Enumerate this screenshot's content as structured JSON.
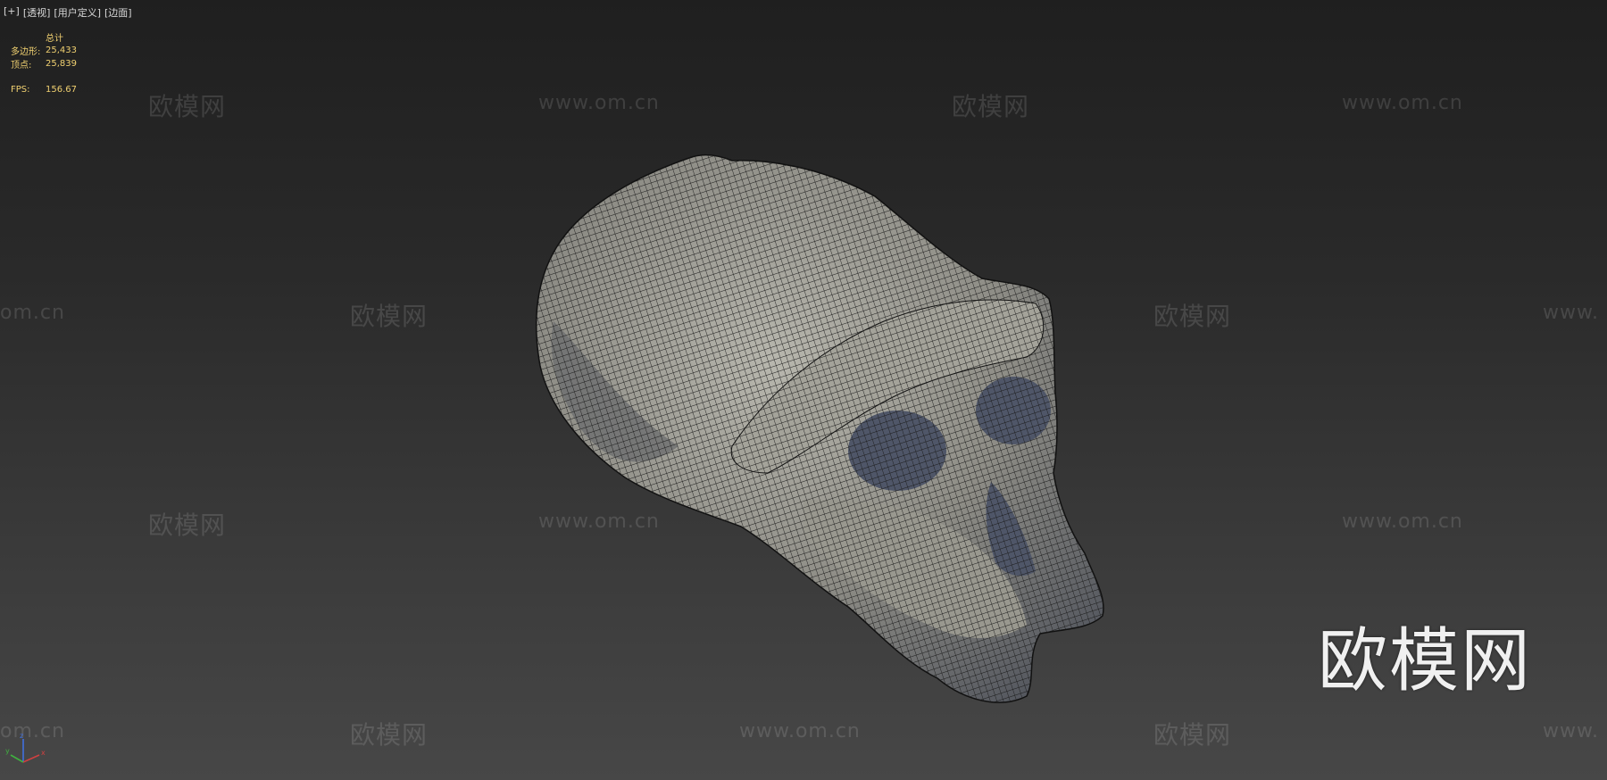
{
  "viewport": {
    "menu": [
      "[+]",
      "[透视]",
      "[用户定义]",
      "[边面]"
    ]
  },
  "stats": {
    "header": "总计",
    "polygons_label": "多边形:",
    "polygons_value": "25,433",
    "vertices_label": "顶点:",
    "vertices_value": "25,839",
    "fps_label": "FPS:",
    "fps_value": "156.67"
  },
  "watermarks": {
    "brand": "欧模网",
    "url": "www.om.cn",
    "url_clipped_left": "om.cn",
    "url_clipped_right": "www."
  },
  "model": {
    "subject": "skull-mesh",
    "shading": "edged-faces",
    "colors": {
      "surface": "#8e8d86",
      "wire": "#1a1a1a",
      "shadow": "#4f5668"
    }
  },
  "axis_gizmo": {
    "x_color": "#d04040",
    "y_color": "#40b040",
    "z_color": "#4070e0"
  }
}
